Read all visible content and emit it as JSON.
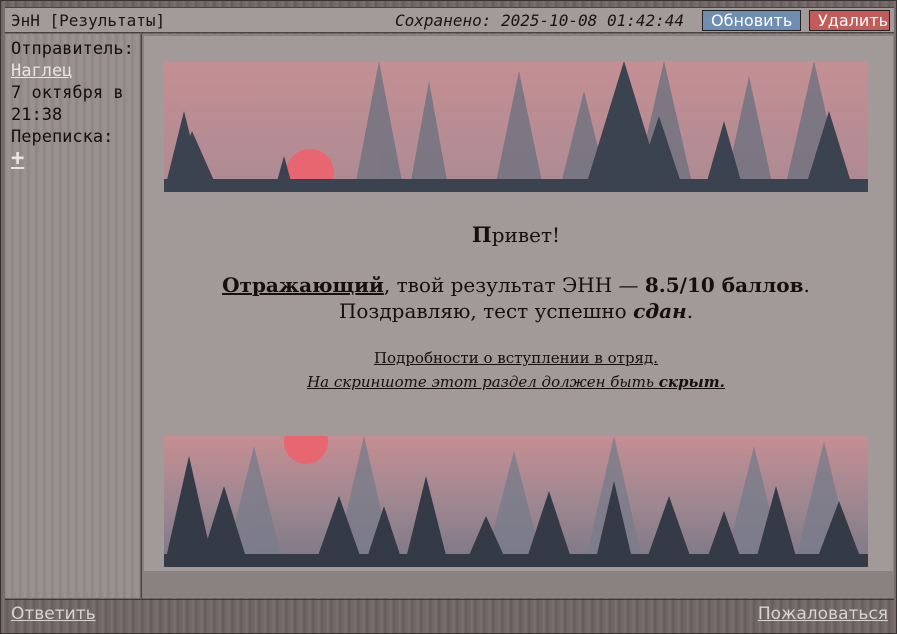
{
  "header": {
    "title": "ЭнН [Результаты]",
    "saved": "Сохранено: 2025-10-08 01:42:44",
    "refresh_label": "Обновить",
    "delete_label": "Удалить"
  },
  "sidebar": {
    "sender_label": "Отправитель:",
    "sender_name": "Наглец",
    "date_line1": "7 октября в",
    "date_line2": "21:38",
    "correspondence_label": "Переписка:",
    "add_label": "+"
  },
  "message": {
    "greeting_initial": "П",
    "greeting_rest": "ривет!",
    "recipient": "Отражающий",
    "result_middle": ", твой результат ЭНН — ",
    "score": "8.5/10 баллов",
    "result_end": ".",
    "congrats_start": "Поздравляю, тест успешно ",
    "passed": "сдан",
    "congrats_end": ".",
    "details_link": "Подробности о вступлении в отряд.",
    "screenshot_note": "На скриншоте этот раздел должен быть ",
    "hidden_word": "скрыт.",
    "image_subject": "forest at sunset"
  },
  "footer": {
    "reply_label": "Ответить",
    "report_label": "Пожаловаться"
  },
  "colors": {
    "refresh_button": "#6f8eb2",
    "delete_button": "#c45b5b",
    "sky": "#c79496",
    "sun": "#e86a70",
    "trees": "#3d4350"
  }
}
